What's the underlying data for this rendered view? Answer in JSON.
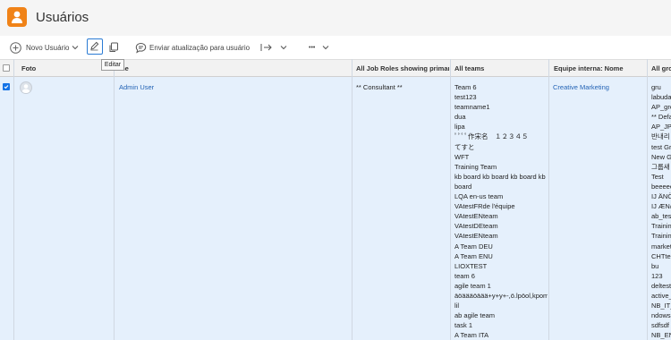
{
  "header": {
    "title": "Usuários"
  },
  "toolbar": {
    "new_user": "Novo Usuário",
    "send_update": "Enviar atualização para usuário",
    "more": "•••"
  },
  "tooltip": "Editar",
  "table": {
    "columns": [
      "Foto",
      "Nome",
      "All Job Roles showing primary",
      "All teams",
      "Equipe interna: Nome",
      "All gro"
    ],
    "row": {
      "selected": true,
      "name": "Admin User",
      "job_role": "** Consultant **",
      "team_home": "Creative Marketing",
      "teams": [
        "Team 6",
        "test123",
        "teamname1",
        "dua",
        "lipa",
        "ﾟﾟﾟﾟ作宋名　１２３４５",
        "てすと",
        "WFT",
        "Training Team",
        "kb board kb board kb board kb",
        "board",
        "LQA en-us team",
        "VAtestFRde l'équipe",
        "VAtestENteam",
        "VAtestDEteam",
        "VAtestENteam",
        "A Team DEU",
        "A Team ENU",
        "LIOXTEST",
        "team 6",
        "agile team 1",
        "äöäääöäää+y+y+-,ö.lpöol,kpom",
        "lil",
        "ab agile team",
        "task 1",
        "A Team ITA"
      ],
      "groups": [
        "gru",
        "labuda",
        "AP_gro",
        "** Defa",
        "AP_JP_",
        "반내리",
        "test Gr",
        "New G",
        "그룹새",
        "Test",
        "beeeee",
        "IJ ÄNÖ",
        "IJ ÆNø",
        "ab_tes",
        "Trainin",
        "Trainin",
        "market",
        "CHTtes",
        "bu",
        "123",
        "deltest",
        "active_",
        "NB_IT_",
        "ndows",
        "sdfsdf",
        "NB_EN"
      ]
    }
  },
  "colors": {
    "brand": "#f08318",
    "accent": "#1473e6",
    "link": "#2363b5",
    "row_selected": "#e5f0fc"
  }
}
